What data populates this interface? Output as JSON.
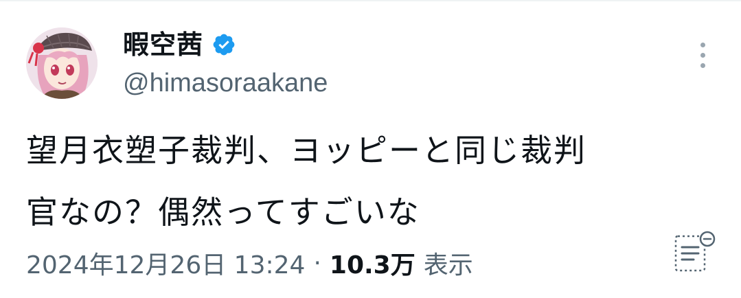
{
  "tweet": {
    "display_name": "暇空茜",
    "verified_icon": "verified-badge-icon",
    "handle": "@himasoraakane",
    "more_icon": "more-vertical-icon",
    "text_lines": [
      "望月衣塑子裁判、ヨッピーと同じ裁判",
      "官なの？偶然ってすごいな"
    ],
    "timestamp": "2024年12月26日 13:24",
    "separator": "·",
    "views_count": "10.3万",
    "views_label": "表示",
    "analytics_icon": "analytics-icon"
  },
  "colors": {
    "text_primary": "#0f1419",
    "text_secondary": "#536471",
    "verified_blue": "#1d9bf0",
    "icon_gray": "#9aa6b0"
  }
}
